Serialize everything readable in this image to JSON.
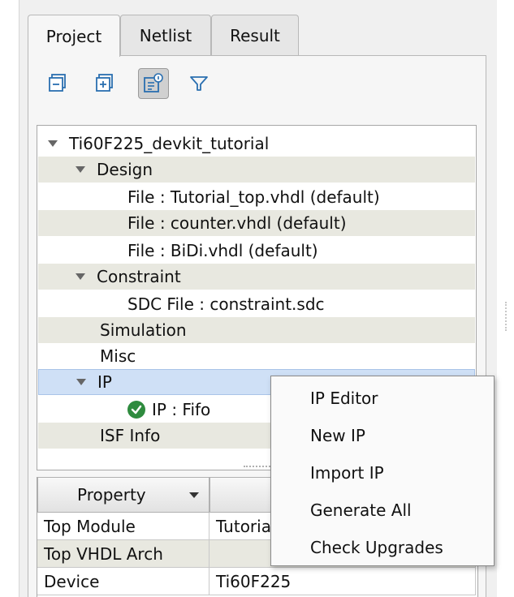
{
  "tabs": [
    {
      "label": "Project"
    },
    {
      "label": "Netlist"
    },
    {
      "label": "Result"
    }
  ],
  "toolbar": {
    "icons": [
      "collapse-all-icon",
      "expand-all-icon",
      "show-details-icon",
      "filter-icon"
    ]
  },
  "tree": {
    "root": "Ti60F225_devkit_tutorial",
    "design": {
      "label": "Design",
      "files": [
        "File : Tutorial_top.vhdl (default)",
        "File : counter.vhdl (default)",
        "File : BiDi.vhdl (default)"
      ]
    },
    "constraint": {
      "label": "Constraint",
      "files": [
        "SDC File : constraint.sdc"
      ]
    },
    "simulation": "Simulation",
    "misc": "Misc",
    "ip": {
      "label": "IP",
      "items": [
        "IP : Fifo"
      ]
    },
    "isf": "ISF Info"
  },
  "properties": {
    "header": "Property",
    "rows": [
      {
        "name": "Top Module",
        "value": "Tutoria"
      },
      {
        "name": "Top VHDL Arch",
        "value": ""
      },
      {
        "name": "Device",
        "value": "Ti60F225"
      }
    ]
  },
  "context_menu": {
    "items": [
      "IP Editor",
      "New IP",
      "Import IP",
      "Generate All",
      "Check Upgrades"
    ]
  },
  "colors": {
    "selection": "#cfe0f6",
    "alt_row": "#e8e8e0",
    "check_green": "#2e8b3e",
    "icon_blue": "#2a6fb0"
  }
}
